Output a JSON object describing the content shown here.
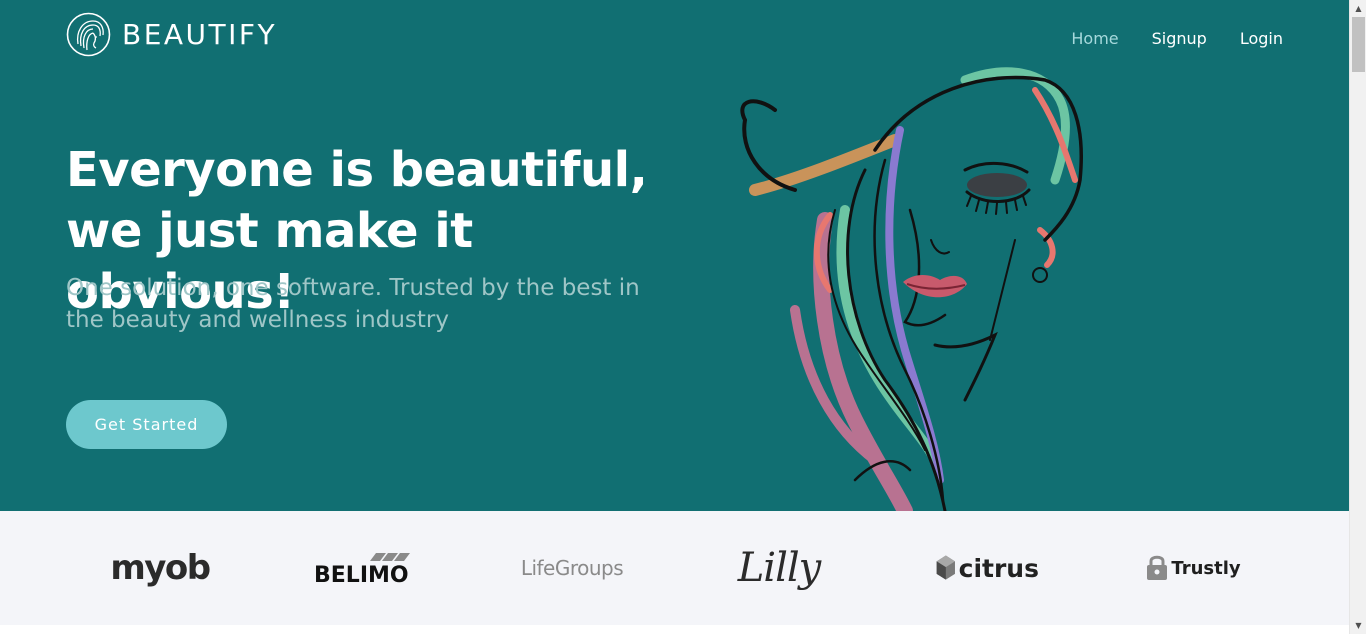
{
  "brand": {
    "name": "BEAUTIFY",
    "logo_icon": "woman-face-circle-logo"
  },
  "nav": {
    "items": [
      {
        "label": "Home",
        "active": true
      },
      {
        "label": "Signup",
        "active": false
      },
      {
        "label": "Login",
        "active": false
      }
    ]
  },
  "hero": {
    "headline_line1": "Everyone is beautiful,",
    "headline_line2": "we just make it obvious!",
    "subhead_line1": "One solution, one software. Trusted by the best in",
    "subhead_line2": "the beauty and wellness industry",
    "cta_label": "Get Started",
    "illustration": "woman-face-line-art"
  },
  "partners": {
    "logos": [
      {
        "name": "myob",
        "text": "myob"
      },
      {
        "name": "belimo",
        "text": "BELIMO"
      },
      {
        "name": "lifegroups",
        "text": "LifeGroups"
      },
      {
        "name": "lilly",
        "text": "Lilly"
      },
      {
        "name": "citrus",
        "text": "citrus"
      },
      {
        "name": "trustly",
        "text": "Trustly"
      }
    ]
  },
  "colors": {
    "hero_bg": "#116f72",
    "cta_bg": "#6dc8cd",
    "nav_active": "#a6d9dc",
    "subhead": "#9fc6c7",
    "logos_bg": "#f4f5f9"
  }
}
